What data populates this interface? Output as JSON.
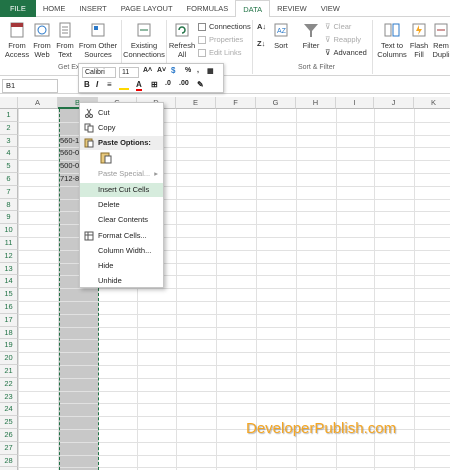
{
  "tabs": [
    "FILE",
    "HOME",
    "INSERT",
    "PAGE LAYOUT",
    "FORMULAS",
    "DATA",
    "REVIEW",
    "VIEW"
  ],
  "active_tab": "DATA",
  "ribbon": {
    "from_access": [
      "From",
      "Access"
    ],
    "from_web": [
      "From",
      "Web"
    ],
    "from_text": [
      "From",
      "Text"
    ],
    "from_other": [
      "From Other",
      "Sources"
    ],
    "existing": [
      "Existing",
      "Connections"
    ],
    "refresh": [
      "Refresh",
      "All"
    ],
    "connections": "Connections",
    "properties": "Properties",
    "edit_links": "Edit Links",
    "sort": "Sort",
    "filter": "Filter",
    "clear": "Clear",
    "reapply": "Reapply",
    "advanced": "Advanced",
    "text_to_columns": [
      "Text to",
      "Columns"
    ],
    "flash_fill": [
      "Flash",
      "Fill"
    ],
    "remove_dup": [
      "Rem",
      "Dupli"
    ],
    "group_get_ext": "Get Ext",
    "group_sort_filter": "Sort & Filter"
  },
  "name_box": "B1",
  "columns": [
    "A",
    "B",
    "C",
    "D",
    "E",
    "F",
    "G",
    "H",
    "I",
    "J",
    "K"
  ],
  "selected_column": "B",
  "rows": [
    "1",
    "2",
    "3",
    "4",
    "5",
    "6",
    "7",
    "8",
    "9",
    "10",
    "11",
    "12",
    "13",
    "14",
    "15",
    "16",
    "17",
    "18",
    "19",
    "20",
    "21",
    "22",
    "23",
    "24",
    "25",
    "26",
    "27",
    "28",
    "29"
  ],
  "cells": {
    "B3": "560-1",
    "B4": "560-0",
    "B5": "500-0",
    "B6": "712-8"
  },
  "mini_toolbar": {
    "font": "Calibri",
    "size": "11",
    "bold": "B",
    "italic": "I"
  },
  "context_menu": {
    "cut": "Cut",
    "copy": "Copy",
    "paste_options": "Paste Options:",
    "paste_special": "Paste Special...",
    "insert_cut_cells": "Insert Cut Cells",
    "delete": "Delete",
    "clear_contents": "Clear Contents",
    "format_cells": "Format Cells...",
    "column_width": "Column Width...",
    "hide": "Hide",
    "unhide": "Unhide"
  },
  "watermark": "DeveloperPublish.com",
  "colors": {
    "excel_green": "#217346",
    "highlight": "#d6ecdd",
    "watermark": "#f5a623"
  }
}
